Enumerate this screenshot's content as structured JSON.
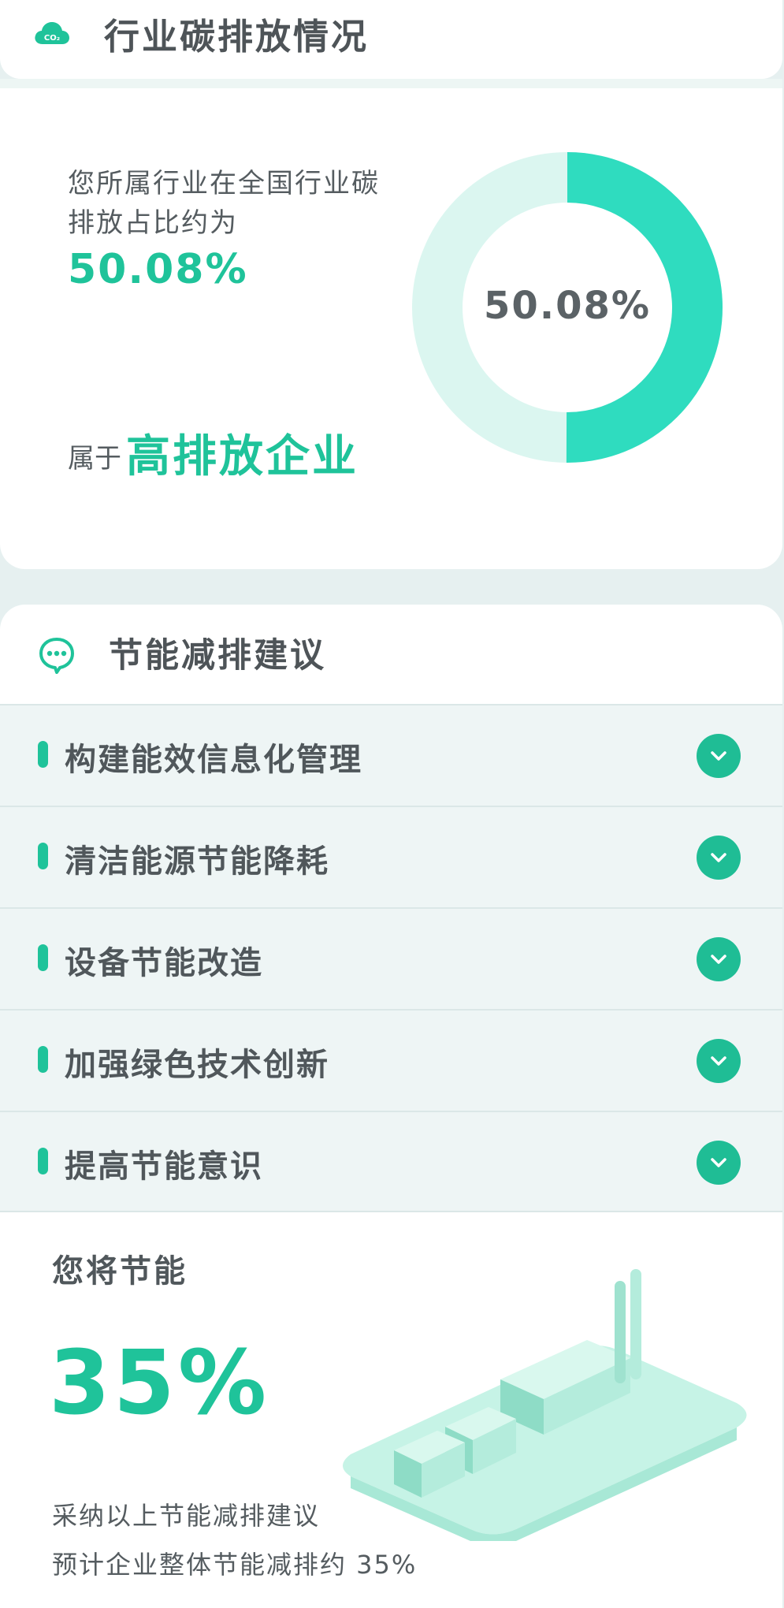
{
  "emission": {
    "title": "行业碳排放情况",
    "share_text": "您所属行业在全国行业碳排放占比约为",
    "share_value": "50.08%",
    "share_fraction": 0.5008,
    "belong_prefix": "属于",
    "belong_level": "高排放企业",
    "co2_badge": "CO₂",
    "donut_label": "50.08%",
    "colors": {
      "accent": "#2fdcbf",
      "track": "#dbf6f0",
      "text_accent": "#1fc39a"
    }
  },
  "suggestions": {
    "title": "节能减排建议",
    "items": [
      {
        "label": "构建能效信息化管理"
      },
      {
        "label": "清洁能源节能降耗"
      },
      {
        "label": "设备节能改造"
      },
      {
        "label": "加强绿色技术创新"
      },
      {
        "label": "提高节能意识"
      }
    ]
  },
  "savings": {
    "label": "您将节能",
    "value": "35%",
    "note_line1": "采纳以上节能减排建议",
    "note_line2": "预计企业整体节能减排约 35%"
  },
  "icons": {
    "header": "co2-cloud-icon",
    "suggestions": "chat-bubble-icon",
    "expand": "chevron-down-icon",
    "illustration": "factory-illustration"
  }
}
